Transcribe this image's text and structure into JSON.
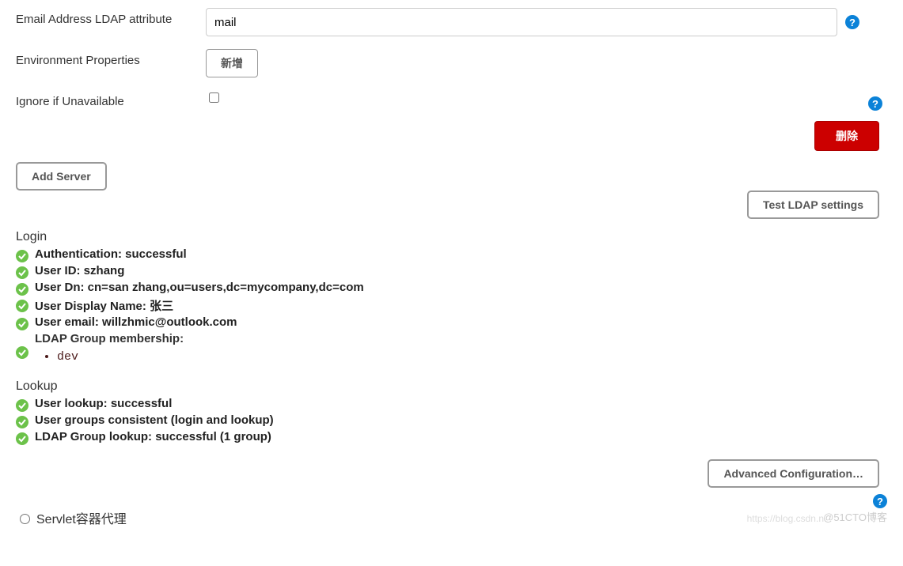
{
  "fields": {
    "email_attr_label": "Email Address LDAP attribute",
    "email_attr_value": "mail",
    "env_props_label": "Environment Properties",
    "env_props_button": "新增",
    "ignore_label": "Ignore if Unavailable"
  },
  "buttons": {
    "delete": "删除",
    "add_server": "Add Server",
    "test_ldap": "Test LDAP settings",
    "advanced": "Advanced Configuration…"
  },
  "login": {
    "heading": "Login",
    "lines": [
      "Authentication: successful",
      "User ID: szhang",
      "User Dn: cn=san zhang,ou=users,dc=mycompany,dc=com",
      "User Display Name: 张三",
      "User email: willzhmic@outlook.com"
    ],
    "group_label": "LDAP Group membership:",
    "groups": [
      "dev"
    ]
  },
  "lookup": {
    "heading": "Lookup",
    "lines": [
      "User lookup: successful",
      "User groups consistent (login and lookup)",
      "LDAP Group lookup: successful (1 group)"
    ]
  },
  "radio": {
    "servlet_label": "Servlet容器代理"
  },
  "watermarks": {
    "w1": "https://blog.csdn.n",
    "w2": "@51CTO博客"
  }
}
